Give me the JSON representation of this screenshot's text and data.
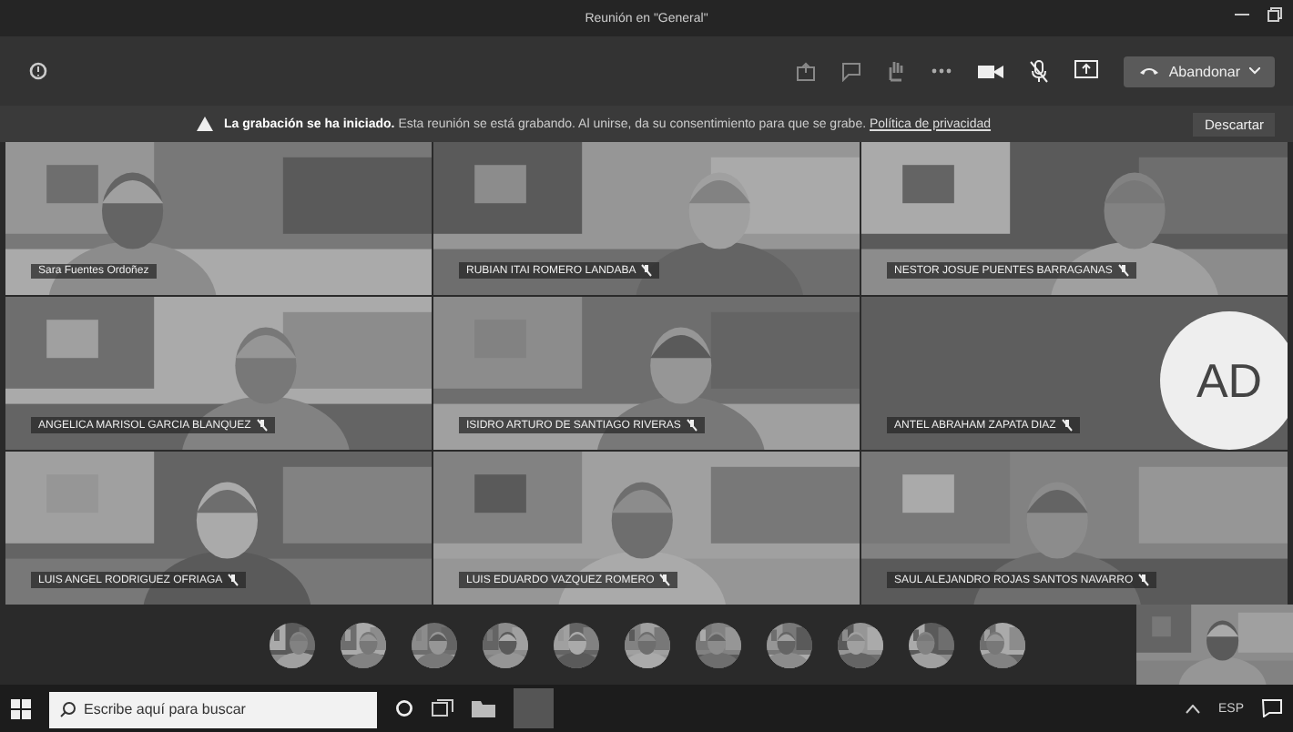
{
  "window": {
    "title": "Reunión en \"General\""
  },
  "toolbar": {
    "leave_button": "Abandonar"
  },
  "banner": {
    "message": "**La grabación se ha iniciado.** Esta reunión se está grabando. Al unirse, da su consentimiento para que se grabe.",
    "link": "Política de privacidad",
    "dismiss": "Descartar"
  },
  "grid_rows": [
    {
      "tiles": [
        {
          "name": "Sara Fuentes Ordoñez",
          "muted": false,
          "kind": "video"
        },
        {
          "name": "RUBIAN ITAI ROMERO LANDABA",
          "muted": true,
          "kind": "video"
        },
        {
          "name": "NESTOR JOSUE PUENTES BARRAGANAS",
          "muted": true,
          "kind": "video"
        }
      ]
    },
    {
      "tiles": [
        {
          "name": "ANGELICA MARISOL GARCIA BLANQUEZ",
          "muted": true,
          "kind": "video"
        },
        {
          "name": "ISIDRO ARTURO DE SANTIAGO RIVERAS",
          "muted": true,
          "kind": "video"
        },
        {
          "name": "ANTEL ABRAHAM ZAPATA DIAZ",
          "muted": true,
          "kind": "avatar",
          "initials": "AD"
        }
      ]
    },
    {
      "tiles": [
        {
          "name": "LUIS ANGEL RODRIGUEZ OFRIAGA",
          "muted": true,
          "kind": "video"
        },
        {
          "name": "LUIS EDUARDO VAZQUEZ ROMERO",
          "muted": true,
          "kind": "video"
        },
        {
          "name": "SAUL ALEJANDRO ROJAS SANTOS NAVARRO",
          "muted": true,
          "kind": "video"
        }
      ]
    }
  ],
  "taskbar": {
    "search": {
      "placeholder": "Escribe aquí para buscar"
    },
    "language": "ESP"
  }
}
